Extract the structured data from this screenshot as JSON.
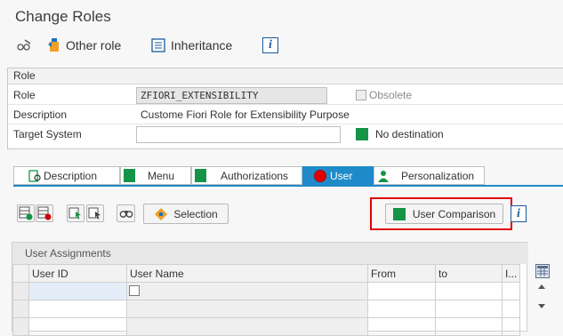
{
  "window": {
    "title": "Change Roles"
  },
  "toolbar": {
    "other_role": "Other role",
    "inheritance": "Inheritance",
    "info_icon": "i"
  },
  "role_section": {
    "header": "Role",
    "role_label": "Role",
    "role_value": "ZFIORI_EXTENSIBILITY",
    "obsolete_label": "Obsolete",
    "description_label": "Description",
    "description_value": "Custome Fiori Role for Extensibility Purpose",
    "target_system_label": "Target System",
    "target_system_value": "",
    "destination_text": "No destination"
  },
  "tabs": [
    {
      "label": "Description"
    },
    {
      "label": "Menu"
    },
    {
      "label": "Authorizations"
    },
    {
      "label": "User"
    },
    {
      "label": "Personalization"
    }
  ],
  "user_toolbar": {
    "selection": "Selection",
    "user_comparison": "User Comparison"
  },
  "user_assignments": {
    "header": "User Assignments",
    "columns": [
      "User ID",
      "User Name",
      "From",
      "to",
      "I..."
    ],
    "rows": [
      [
        "",
        "",
        "",
        "",
        ""
      ],
      [
        "",
        "",
        "",
        "",
        ""
      ],
      [
        "",
        "",
        "",
        "",
        ""
      ]
    ]
  },
  "colors": {
    "accent_blue": "#1f8ac9",
    "status_green": "#159447",
    "highlight_red": "#e00000"
  }
}
